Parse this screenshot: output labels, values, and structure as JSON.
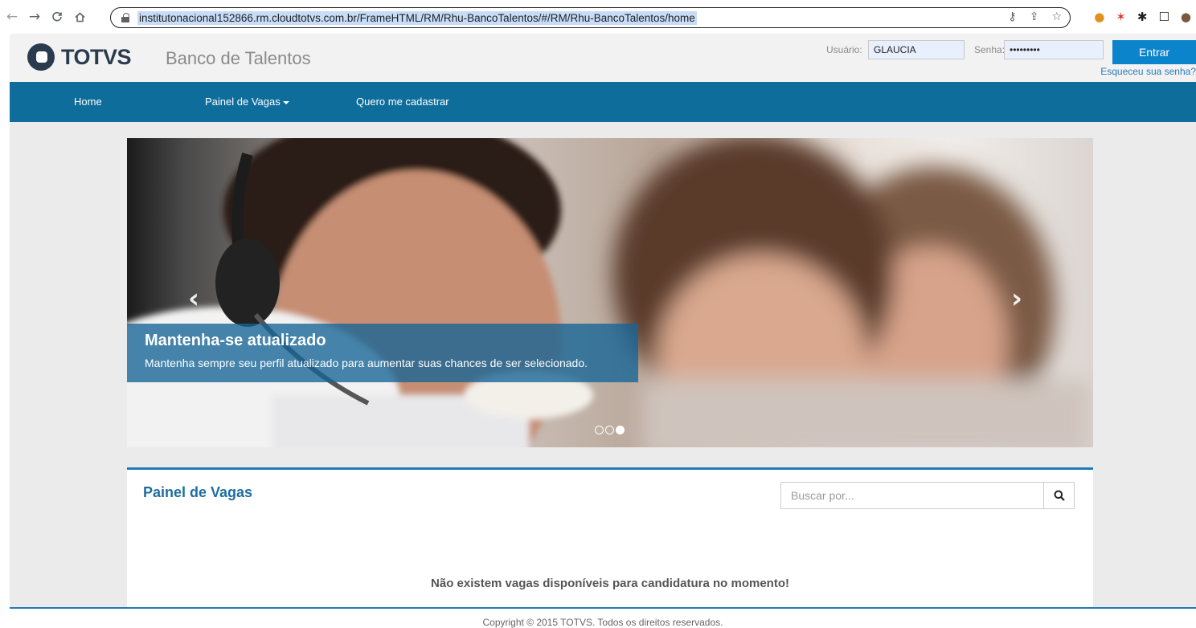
{
  "browser": {
    "url": "institutonacional152866.rm.cloudtotvs.com.br/FrameHTML/RM/Rhu-BancoTalentos/#/RM/Rhu-BancoTalentos/home",
    "back_icon": "arrow-left-icon",
    "forward_icon": "arrow-right-icon",
    "reload_icon": "reload-icon",
    "home_icon": "home-icon"
  },
  "header": {
    "logo_text": "TOTVS",
    "app_title": "Banco de Talentos",
    "login": {
      "user_label": "Usuário:",
      "user_value": "GLAUCIA",
      "password_label": "Senha:",
      "password_value": "•••••••••",
      "submit_label": "Entrar",
      "forgot_label": "Esqueceu sua senha?"
    }
  },
  "nav": {
    "items": [
      {
        "label": "Home"
      },
      {
        "label": "Painel de Vagas"
      },
      {
        "label": "Quero me cadastrar"
      }
    ]
  },
  "carousel": {
    "caption_title": "Mantenha-se atualizado",
    "caption_text": "Mantenha sempre seu perfil atualizado para aumentar suas chances de ser selecionado.",
    "prev_label": "‹",
    "next_label": "›",
    "slide_count": 3,
    "active_slide": 3
  },
  "panel": {
    "title": "Painel de Vagas",
    "search_placeholder": "Buscar por...",
    "empty_message": "Não existem vagas disponíveis para candidatura no momento!"
  },
  "footer": {
    "copyright": "Copyright © 2015 TOTVS. Todos os direitos reservados."
  },
  "colors": {
    "brand_blue": "#0f6d9b",
    "accent_blue": "#1d7db4",
    "button_blue": "#0b84cc"
  }
}
